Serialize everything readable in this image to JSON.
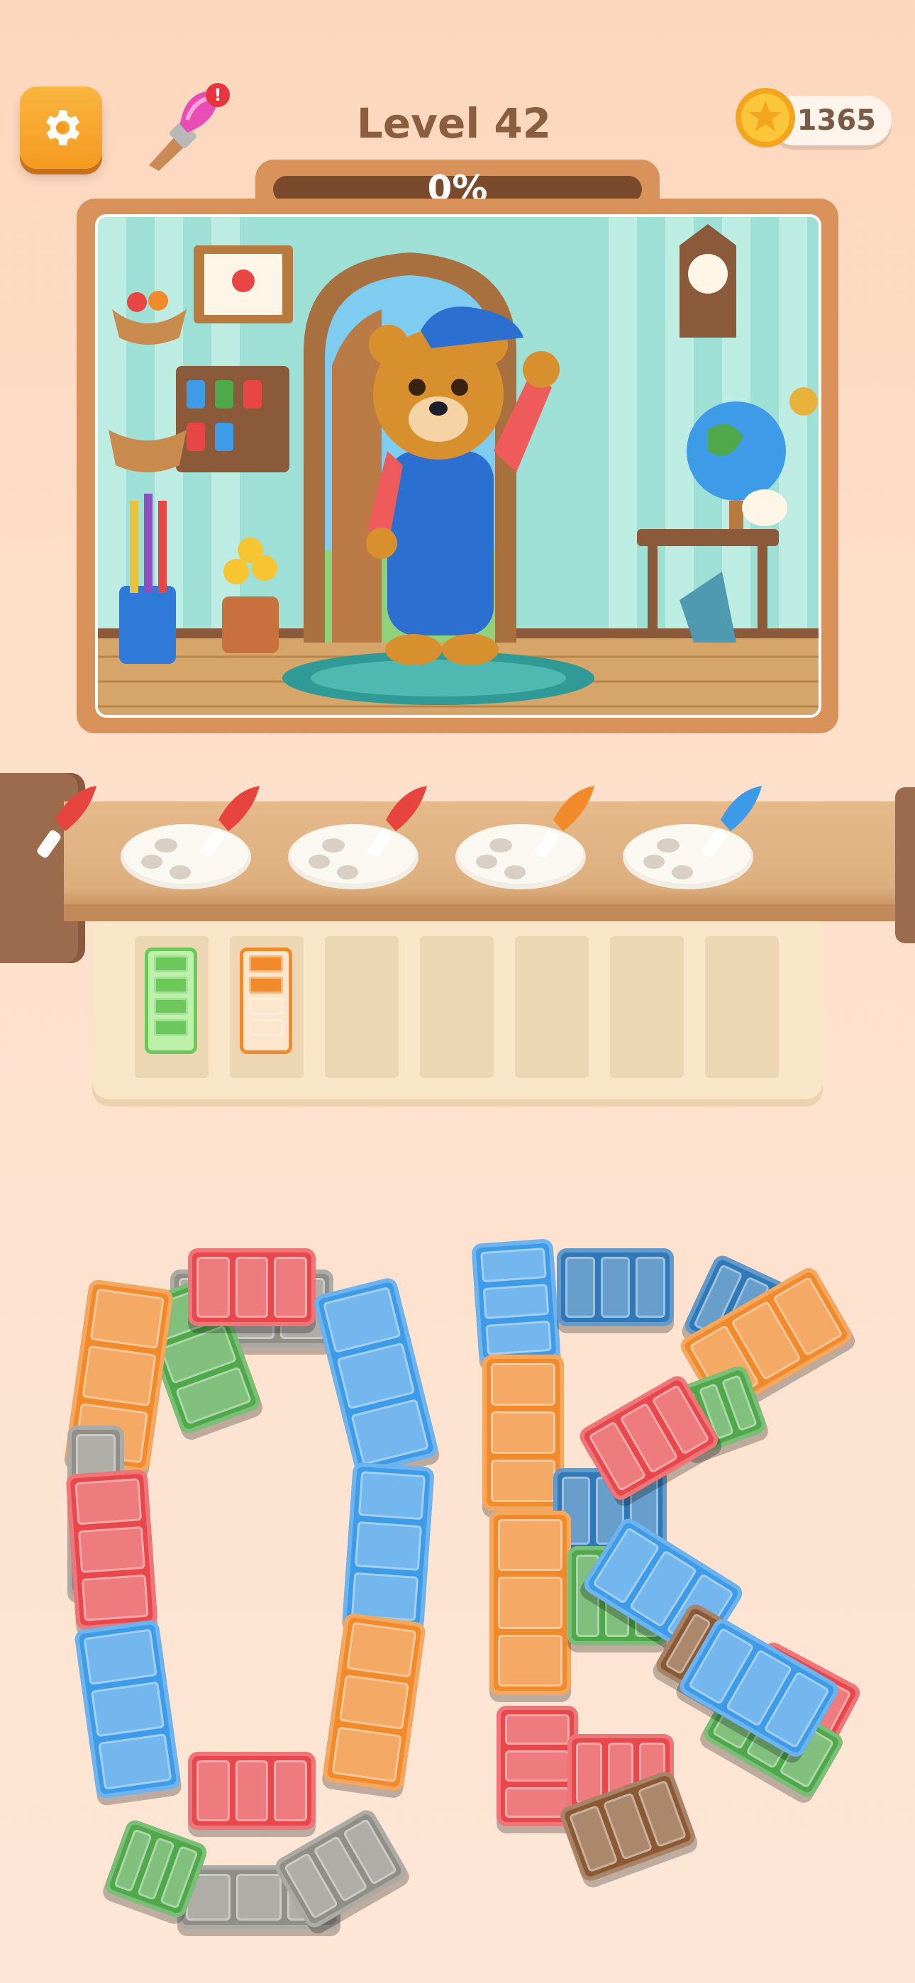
{
  "hud": {
    "level_title": "Level 42",
    "coins": "1365",
    "settings_icon": "gear-icon",
    "brush_icon": "paintbrush-icon",
    "brush_badge": "!"
  },
  "progress": {
    "text": "0%",
    "value": 0
  },
  "picture": {
    "subject": "bear-in-overalls-illustration"
  },
  "conveyor": {
    "palettes": [
      {
        "brush_color": "#e8443f"
      },
      {
        "brush_color": "#e8443f"
      },
      {
        "brush_color": "#e8443f"
      },
      {
        "brush_color": "#f08a2a"
      },
      {
        "brush_color": "#3c9ae6"
      }
    ],
    "partial_left_brush_color": "#e8443f"
  },
  "tray": {
    "slots": [
      {
        "filled": true,
        "color": "#6cc85a",
        "light": "#bdf0a8",
        "segments_filled": 4
      },
      {
        "filled": true,
        "color": "#f08a2a",
        "light": "#fde6cc",
        "segments_filled": 2
      },
      {
        "filled": false
      },
      {
        "filled": false
      },
      {
        "filled": false
      },
      {
        "filled": false
      },
      {
        "filled": false
      }
    ]
  },
  "colors": {
    "orange": "#f08a2a",
    "red": "#e8484c",
    "blue": "#3d9be8",
    "green": "#4fa84a",
    "darkblue": "#2f79b8",
    "brown": "#8b5a34",
    "gray": "#8f8e87",
    "accent_gold": "#f59a21"
  }
}
